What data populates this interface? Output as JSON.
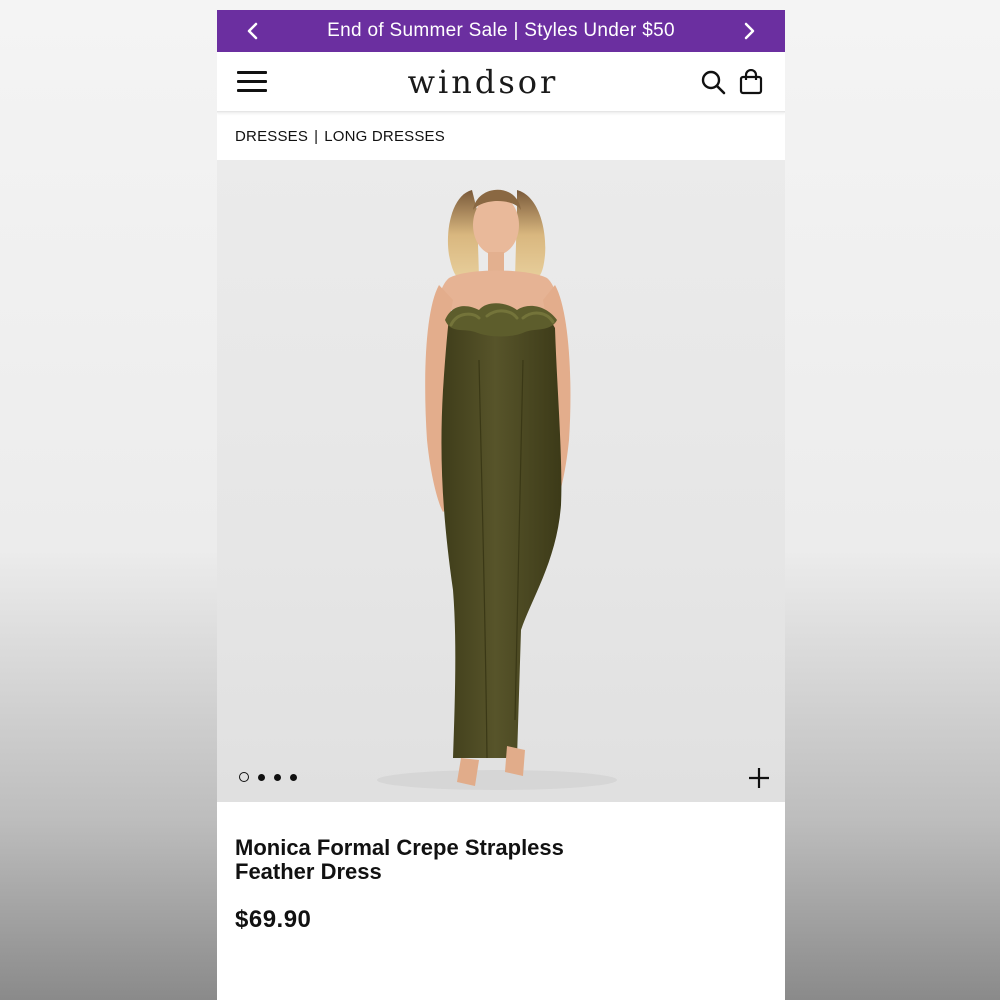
{
  "promo": {
    "text": "End of Summer Sale | Styles Under $50",
    "prev_icon": "chevron-left-icon",
    "next_icon": "chevron-right-icon"
  },
  "header": {
    "logo": "windsor",
    "menu_icon": "hamburger-menu-icon",
    "search_icon": "search-icon",
    "bag_icon": "shopping-bag-icon"
  },
  "breadcrumb": {
    "items": [
      "DRESSES",
      "LONG DRESSES"
    ],
    "separator": "|"
  },
  "gallery": {
    "image_alt": "Model wearing olive strapless dress with feather trim",
    "slide_count": 4,
    "active_slide": 1,
    "zoom_icon": "plus-icon"
  },
  "product": {
    "title": "Monica Formal Crepe Strapless Feather Dress",
    "price": "$69.90"
  },
  "colors": {
    "promo_bg": "#6b2fa0",
    "dress": "#4f4c22",
    "text": "#111111"
  }
}
